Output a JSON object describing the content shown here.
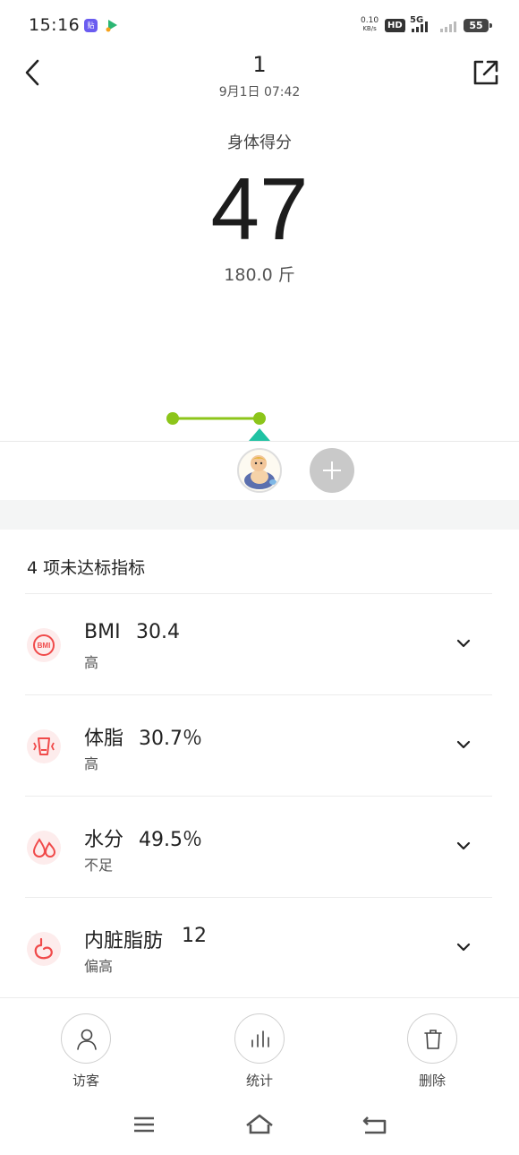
{
  "status_bar": {
    "time": "15:16",
    "net_speed_value": "0.10",
    "net_speed_unit": "KB/s",
    "hd_label": "HD",
    "hd_sub": "1",
    "network": "5G",
    "battery": "55"
  },
  "header": {
    "title": "1",
    "datetime": "9月1日 07:42"
  },
  "score": {
    "label": "身体得分",
    "value": "47",
    "weight": "180.0 斤"
  },
  "trend_chart": {
    "points": 2,
    "line_color": "#8cc51a",
    "marker_color": "#1fc2a3"
  },
  "section": {
    "title": "4 项未达标指标"
  },
  "metrics": [
    {
      "name": "BMI",
      "value": "30.4",
      "status": "高",
      "icon": "bmi-icon"
    },
    {
      "name": "体脂",
      "value": "30.7％",
      "status": "高",
      "icon": "body-fat-icon"
    },
    {
      "name": "水分",
      "value": "49.5％",
      "status": "不足",
      "icon": "water-drops-icon"
    },
    {
      "name": "内脏脂肪",
      "value": "12",
      "status": "偏高",
      "icon": "visceral-fat-icon"
    }
  ],
  "actions": [
    {
      "label": "访客",
      "icon": "visitor-icon"
    },
    {
      "label": "统计",
      "icon": "statistics-icon"
    },
    {
      "label": "删除",
      "icon": "trash-icon"
    }
  ],
  "colors": {
    "accent_red": "#f04a4a",
    "icon_bg": "#fdecec",
    "chart_green": "#8cc51a",
    "marker_teal": "#1fc2a3"
  }
}
